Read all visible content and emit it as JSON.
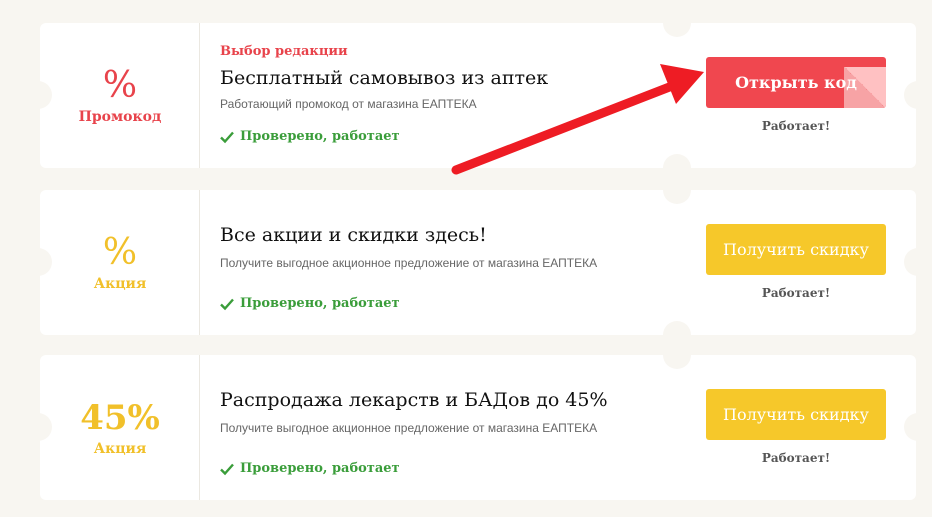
{
  "coupons": [
    {
      "value": "%",
      "kind": "Промокод",
      "badge": "Выбор редакции",
      "title": "Бесплатный самовывоз из аптек",
      "description": "Работающий промокод от магазина ЕАПТЕКА",
      "verified": "Проверено, работает",
      "button": "Открыть код",
      "status": "Работает!"
    },
    {
      "value": "%",
      "kind": "Акция",
      "title": "Все акции и скидки здесь!",
      "description": "Получите выгодное акционное предложение от магазина ЕАПТЕКА",
      "verified": "Проверено, работает",
      "button": "Получить скидку",
      "status": "Работает!"
    },
    {
      "value": "45%",
      "kind": "Акция",
      "title": "Распродажа лекарств и БАДов до 45%",
      "description": "Получите выгодное акционное предложение от магазина ЕАПТЕКА",
      "verified": "Проверено, работает",
      "button": "Получить скидку",
      "status": "Работает!"
    }
  ],
  "colors": {
    "promo": "#e8434b",
    "deal": "#f1c02a",
    "verified": "#3a9d3a",
    "arrow": "#ee1c24"
  }
}
